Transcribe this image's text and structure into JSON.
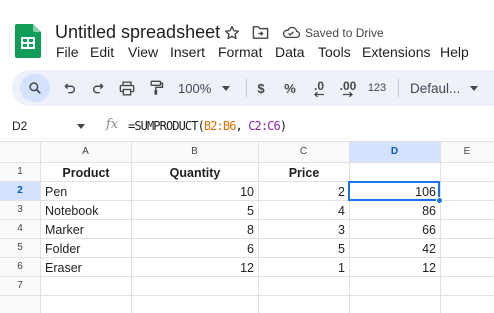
{
  "document": {
    "title": "Untitled spreadsheet",
    "save_status": "Saved to Drive"
  },
  "menu": [
    "File",
    "Edit",
    "View",
    "Insert",
    "Format",
    "Data",
    "Tools",
    "Extensions",
    "Help"
  ],
  "toolbar": {
    "zoom": "100%",
    "currency": "$",
    "percent": "%",
    "decrease_decimal": ".0",
    "increase_decimal": ".00",
    "number_format": "123",
    "font": "Defaul..."
  },
  "formula_bar": {
    "cell_ref": "D2",
    "fx": "fx",
    "formula_prefix": "=SUMPRODUCT(",
    "range1": "B2:B6",
    "sep": ", ",
    "range2": "C2:C6",
    "formula_suffix": ")"
  },
  "grid": {
    "columns": [
      "A",
      "B",
      "C",
      "D",
      "E"
    ],
    "rows": [
      "1",
      "2",
      "3",
      "4",
      "5",
      "6",
      "7"
    ],
    "selected_cell": "D2",
    "headers": [
      "Product",
      "Quantity",
      "Price",
      ""
    ],
    "data": [
      [
        "Pen",
        "10",
        "2",
        "106"
      ],
      [
        "Notebook",
        "5",
        "4",
        "86"
      ],
      [
        "Marker",
        "8",
        "3",
        "66"
      ],
      [
        "Folder",
        "6",
        "5",
        "42"
      ],
      [
        "Eraser",
        "12",
        "1",
        "12"
      ]
    ]
  },
  "colors": {
    "accent": "#1a73e8",
    "toolbar_bg": "#edf2fa",
    "selected_header_bg": "#d3e3fd",
    "logo_green": "#0f9d58",
    "range1_color": "#e07000",
    "range2_color": "#8e24aa"
  }
}
